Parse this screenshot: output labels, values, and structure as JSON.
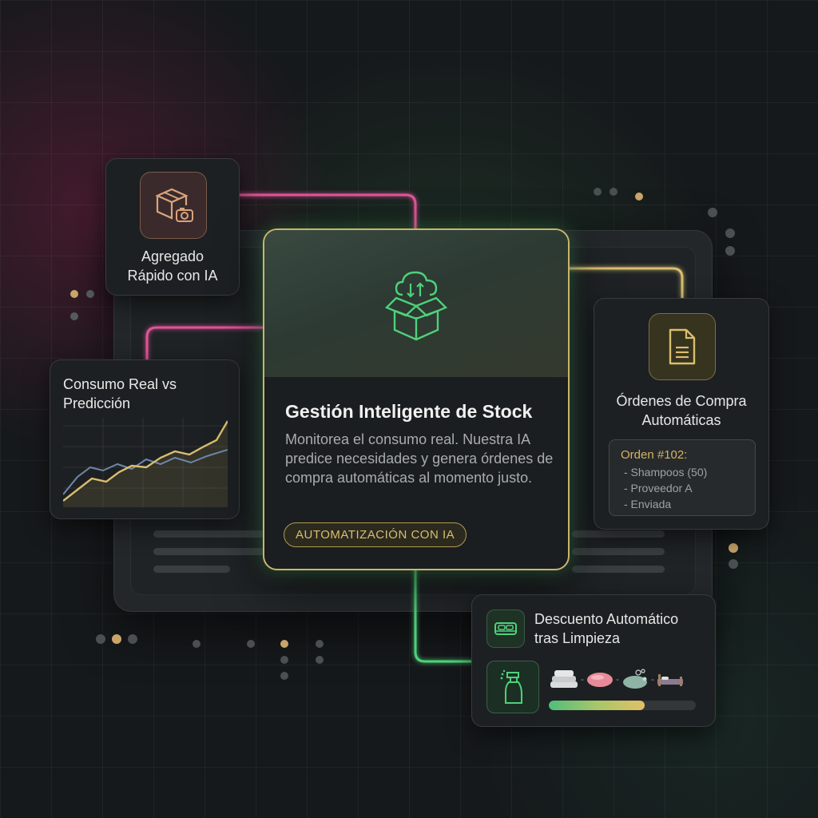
{
  "cards": {
    "agregado": {
      "icon": "package-camera-icon",
      "label_line1": "Agregado",
      "label_line2": "Rápido con IA"
    },
    "consumo": {
      "title_line1": "Consumo Real vs",
      "title_line2": "Predicción"
    },
    "main": {
      "icon": "cloud-box-icon",
      "title": "Gestión Inteligente de Stock",
      "description": "Monitorea el consumo real. Nuestra IA predice necesidades y genera órdenes de compra automáticas al momento justo.",
      "tag": "AUTOMATIZACIÓN CON IA"
    },
    "ordenes": {
      "icon": "document-icon",
      "label_line1": "Órdenes de Compra",
      "label_line2": "Automáticas",
      "order": {
        "title": "Orden #102:",
        "lines": [
          "- Shampoos (50)",
          "- Proveedor A",
          "- Enviada"
        ]
      }
    },
    "descuento": {
      "icon": "bed-icon",
      "tool_icon": "spray-bottle-icon",
      "label_line1": "Descuento Automático",
      "label_line2": "tras Limpieza",
      "items": [
        "towels-icon",
        "soap-icon",
        "soap-bubbles-icon",
        "bed-icon"
      ],
      "progress": 0.65
    }
  },
  "colors": {
    "gold": "#d8be6e",
    "green": "#4fd17a",
    "magenta": "#e0559a",
    "blue_series": "#6f86a8"
  }
}
